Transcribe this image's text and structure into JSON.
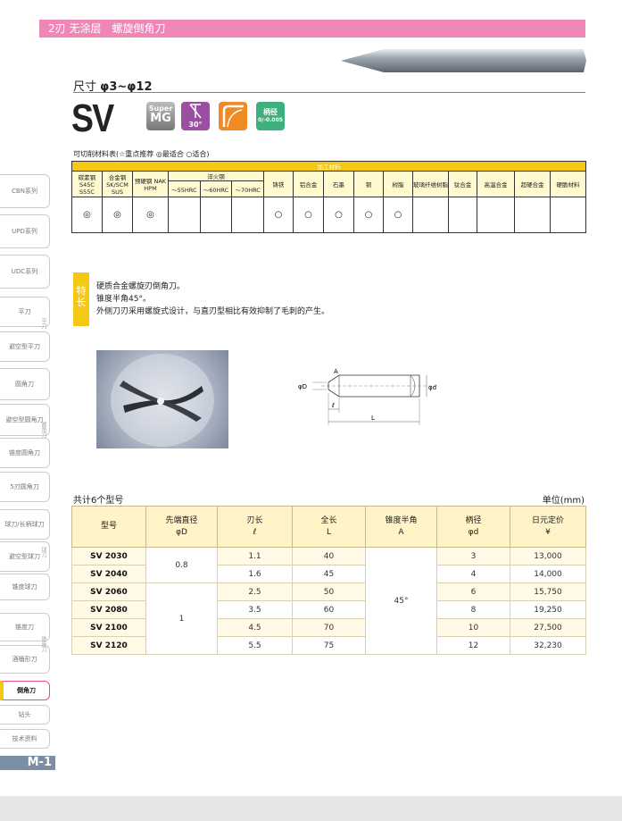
{
  "header": {
    "title": "2刃 无涂层　螺旋倒角刀"
  },
  "size": {
    "label": "尺寸",
    "range": "φ3~φ12"
  },
  "model": {
    "name": "SV"
  },
  "badges": {
    "mg_top": "Super",
    "mg_bottom": "MG",
    "angle": "30°",
    "tol_top": "柄径",
    "tol_bottom": "0/-0.005"
  },
  "materials": {
    "title": "可切削材料表(☆重点推荐 ◎最适合 ○适合)",
    "group_header": "加工材料",
    "cols": [
      "碳素钢 S45C S55C",
      "合金钢 SK/SCM SUS",
      "预硬钢 NAK HPM",
      "淬火钢",
      "铸铁",
      "铝合金",
      "石墨",
      "铜",
      "树脂",
      "玻璃纤维树脂",
      "钛合金",
      "高温合金",
      "超硬合金",
      "硬脆材料"
    ],
    "hardened_sub": [
      "～55HRC",
      "～60HRC",
      "～70HRC"
    ],
    "ratings": [
      "◎",
      "◎",
      "◎",
      "",
      "",
      "",
      "○",
      "○",
      "○",
      "○",
      "○",
      "",
      "",
      "",
      "",
      ""
    ]
  },
  "features": {
    "label": "特长",
    "lines": [
      "硬质合金螺旋刃倒角刀。",
      "锥度半角45°。",
      "外侧刀刃采用螺旋式设计，与直刃型相比有效抑制了毛刺的产生。"
    ]
  },
  "drawing": {
    "d": "φD",
    "a": "A",
    "l_small": "ℓ",
    "l_big": "L",
    "dd": "φd"
  },
  "spec": {
    "count": "共计6个型号",
    "unit": "单位(mm)",
    "headers": [
      {
        "l1": "型号",
        "l2": ""
      },
      {
        "l1": "先端直径",
        "l2": "φD"
      },
      {
        "l1": "刃长",
        "l2": "ℓ"
      },
      {
        "l1": "全长",
        "l2": "L"
      },
      {
        "l1": "锥度半角",
        "l2": "A"
      },
      {
        "l1": "柄径",
        "l2": "φd"
      },
      {
        "l1": "日元定价",
        "l2": "¥"
      }
    ],
    "tip_diam": [
      "0.8",
      "1"
    ],
    "angle": "45°",
    "rows": [
      {
        "model": "SV 2030",
        "l": "1.1",
        "L": "40",
        "d": "3",
        "price": "13,000"
      },
      {
        "model": "SV 2040",
        "l": "1.6",
        "L": "45",
        "d": "4",
        "price": "14,000"
      },
      {
        "model": "SV 2060",
        "l": "2.5",
        "L": "50",
        "d": "6",
        "price": "15,750"
      },
      {
        "model": "SV 2080",
        "l": "3.5",
        "L": "60",
        "d": "8",
        "price": "19,250"
      },
      {
        "model": "SV 2100",
        "l": "4.5",
        "L": "70",
        "d": "10",
        "price": "27,500"
      },
      {
        "model": "SV 2120",
        "l": "5.5",
        "L": "75",
        "d": "12",
        "price": "32,230"
      }
    ]
  },
  "sidebar": {
    "items": [
      "CBN系列",
      "UPD系列",
      "UDC系列",
      "平刀",
      "避空型平刀",
      "圆角刀",
      "避空型圆角刀",
      "锥度圆角刀",
      "5刃圆角刀",
      "球刀/长柄球刀",
      "避空型球刀",
      "锥度球刀",
      "锥度刀",
      "酒桶形刀",
      "倒角刀",
      "钻头",
      "技术资料"
    ],
    "tags": [
      "平刀",
      "圆角刀",
      "球刀",
      "锥度刀"
    ],
    "page": "M-1"
  }
}
